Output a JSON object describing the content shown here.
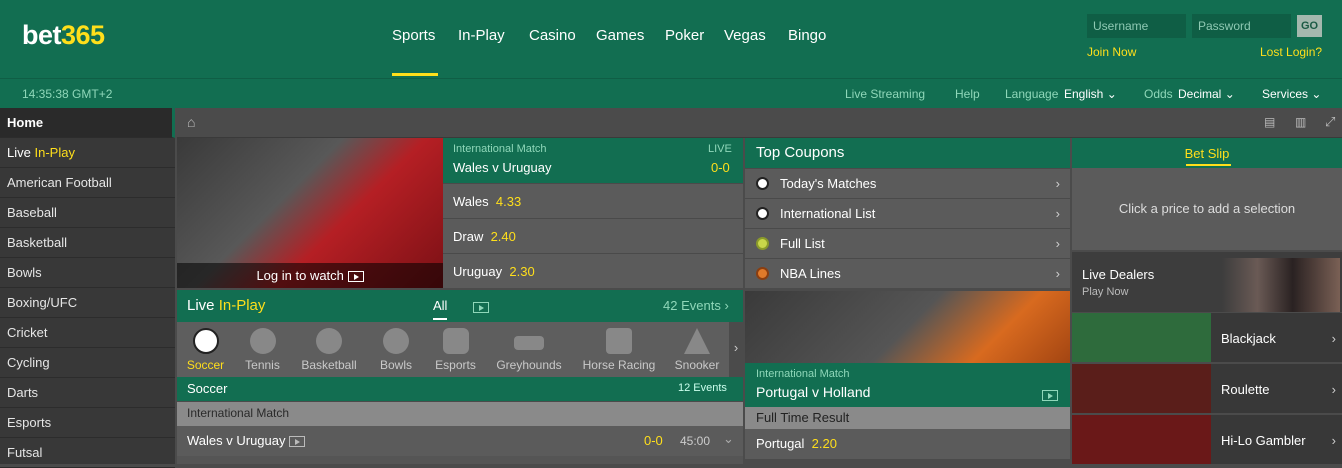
{
  "brand": {
    "logo_a": "bet",
    "logo_b": "365"
  },
  "nav": [
    "Sports",
    "In-Play",
    "Casino",
    "Games",
    "Poker",
    "Vegas",
    "Bingo"
  ],
  "login": {
    "username_placeholder": "Username",
    "password_placeholder": "Password",
    "go": "GO",
    "join": "Join Now",
    "lost": "Lost Login?"
  },
  "subbar": {
    "time": "14:35:38 GMT+2",
    "live_streaming": "Live Streaming",
    "help": "Help",
    "language_label": "Language",
    "language_value": "English",
    "odds_label": "Odds",
    "odds_value": "Decimal",
    "services": "Services"
  },
  "sidebar": [
    "Home",
    "Live",
    "In-Play",
    "American Football",
    "Baseball",
    "Basketball",
    "Bowls",
    "Boxing/UFC",
    "Cricket",
    "Cycling",
    "Darts",
    "Esports",
    "Futsal"
  ],
  "featured": {
    "competition": "International Match",
    "live": "LIVE",
    "match": "Wales v Uruguay",
    "score": "0-0",
    "watch": "Log in to watch",
    "rows": [
      {
        "name": "Wales",
        "odds": "4.33"
      },
      {
        "name": "Draw",
        "odds": "2.40"
      },
      {
        "name": "Uruguay",
        "odds": "2.30"
      }
    ]
  },
  "coupons": {
    "title": "Top Coupons",
    "items": [
      "Today's Matches",
      "International List",
      "Full List",
      "NBA Lines"
    ]
  },
  "betslip": {
    "title": "Bet Slip",
    "empty": "Click a price to add a selection"
  },
  "casino": {
    "live_dealers": "Live Dealers",
    "play_now": "Play Now",
    "games": [
      "Blackjack",
      "Roulette",
      "Hi-Lo Gambler"
    ]
  },
  "inplay": {
    "title_a": "Live",
    "title_b": "In-Play",
    "all": "All",
    "events": "42 Events",
    "sports": [
      "Soccer",
      "Tennis",
      "Basketball",
      "Bowls",
      "Esports",
      "Greyhounds",
      "Horse Racing",
      "Snooker"
    ],
    "section": "Soccer",
    "section_events": "12 Events",
    "competition": "International Match",
    "match": "Wales v Uruguay",
    "score": "0-0",
    "clock": "45:00"
  },
  "portugal": {
    "competition": "International Match",
    "match": "Portugal v Holland",
    "market": "Full Time Result",
    "row": {
      "name": "Portugal",
      "odds": "2.20"
    }
  },
  "colors": {
    "green": "#126e51",
    "yellow": "#ffdf1b",
    "dark": "#383838"
  }
}
